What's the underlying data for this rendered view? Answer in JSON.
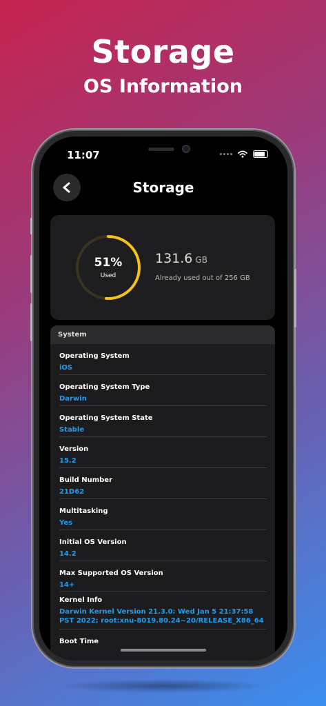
{
  "promo": {
    "title": "Storage",
    "subtitle": "OS Information"
  },
  "status_bar": {
    "time": "11:07"
  },
  "nav": {
    "title": "Storage"
  },
  "storage": {
    "percent_label": "51%",
    "used_label": "Used",
    "used_fraction": 0.51,
    "used_value": "131.6",
    "used_unit": "GB",
    "description": "Already used out of 256 GB",
    "ring_color": "#f5c21b"
  },
  "system": {
    "header": "System",
    "rows": [
      {
        "label": "Operating System",
        "value": "iOS"
      },
      {
        "label": "Operating System Type",
        "value": "Darwin"
      },
      {
        "label": "Operating System State",
        "value": "Stable"
      },
      {
        "label": "Version",
        "value": "15.2"
      },
      {
        "label": "Build Number",
        "value": "21D62"
      },
      {
        "label": "Multitasking",
        "value": "Yes"
      },
      {
        "label": "Initial OS Version",
        "value": "14.2"
      },
      {
        "label": "Max Supported OS Version",
        "value": "14+"
      },
      {
        "label": "Kernel Info",
        "value": "Darwin Kernel Version 21.3.0: Wed Jan  5 21:37:58 PST 2022; root:xnu-8019.80.24~20/RELEASE_X86_64"
      },
      {
        "label": "Boot Time",
        "value": ""
      }
    ]
  },
  "colors": {
    "accent_value": "#1e9df0",
    "ring_track": "#3a3320"
  }
}
